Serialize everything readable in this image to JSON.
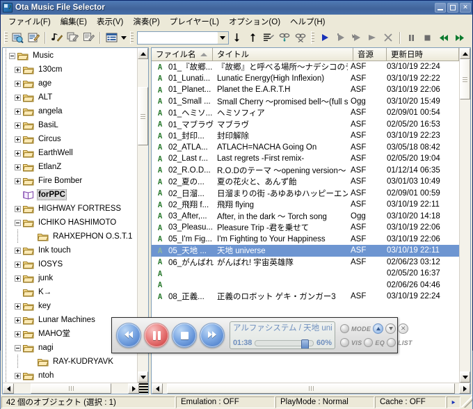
{
  "window": {
    "title": "Ota Music File Selector",
    "icon": "music-note-window-icon",
    "buttons": {
      "minimize": "_",
      "maximize": "□",
      "close": "✕"
    }
  },
  "menu": [
    {
      "label": "ファイル(F)",
      "name": "menu-file"
    },
    {
      "label": "編集(E)",
      "name": "menu-edit"
    },
    {
      "label": "表示(V)",
      "name": "menu-view"
    },
    {
      "label": "演奏(P)",
      "name": "menu-play"
    },
    {
      "label": "プレイヤー(L)",
      "name": "menu-player"
    },
    {
      "label": "オプション(O)",
      "name": "menu-options"
    },
    {
      "label": "ヘルプ(H)",
      "name": "menu-help"
    }
  ],
  "toolbar": {
    "combo_value": "",
    "combo_placeholder": "",
    "icons": [
      "search-folder-icon",
      "edit-properties-icon",
      "music-wand-icon",
      "copy-tag-icon",
      "edit-list-icon",
      "view-details-icon",
      "dropdown-arrow-icon",
      "move-down-icon",
      "move-up-icon",
      "sort-list-icon",
      "link-down-icon",
      "unlink-icon",
      "play-icon",
      "play-gray-icon",
      "play-add-icon",
      "play-next-icon",
      "clear-icon",
      "pause-icon",
      "stop-icon",
      "prev-track-icon",
      "next-track-icon"
    ]
  },
  "tree": {
    "items": [
      {
        "label": "Music",
        "depth": 0,
        "state": "minus",
        "selected": false
      },
      {
        "label": "130cm",
        "depth": 1,
        "state": "plus",
        "selected": false
      },
      {
        "label": "age",
        "depth": 1,
        "state": "plus",
        "selected": false
      },
      {
        "label": "ALT",
        "depth": 1,
        "state": "plus",
        "selected": false
      },
      {
        "label": "angela",
        "depth": 1,
        "state": "plus",
        "selected": false
      },
      {
        "label": "BasiL",
        "depth": 1,
        "state": "plus",
        "selected": false
      },
      {
        "label": "Circus",
        "depth": 1,
        "state": "plus",
        "selected": false
      },
      {
        "label": "EarthWell",
        "depth": 1,
        "state": "plus",
        "selected": false
      },
      {
        "label": "EtlanZ",
        "depth": 1,
        "state": "plus",
        "selected": false
      },
      {
        "label": "Fire Bomber",
        "depth": 1,
        "state": "plus",
        "selected": false
      },
      {
        "label": "forPPC",
        "depth": 1,
        "state": "none",
        "selected": true
      },
      {
        "label": "HIGHWAY FORTRESS",
        "depth": 1,
        "state": "plus",
        "selected": false
      },
      {
        "label": "ICHIKO HASHIMOTO",
        "depth": 1,
        "state": "minus",
        "selected": false
      },
      {
        "label": "RAHXEPHON O.S.T.1",
        "depth": 2,
        "state": "none",
        "selected": false
      },
      {
        "label": "Ink touch",
        "depth": 1,
        "state": "plus",
        "selected": false
      },
      {
        "label": "IOSYS",
        "depth": 1,
        "state": "plus",
        "selected": false
      },
      {
        "label": "junk",
        "depth": 1,
        "state": "plus",
        "selected": false
      },
      {
        "label": "K→",
        "depth": 1,
        "state": "none",
        "selected": false
      },
      {
        "label": "key",
        "depth": 1,
        "state": "plus",
        "selected": false
      },
      {
        "label": "Lunar Machines",
        "depth": 1,
        "state": "plus",
        "selected": false
      },
      {
        "label": "MAHO堂",
        "depth": 1,
        "state": "plus",
        "selected": false
      },
      {
        "label": "nagi",
        "depth": 1,
        "state": "minus",
        "selected": false
      },
      {
        "label": "RAY-KUDRYAVK",
        "depth": 2,
        "state": "none",
        "selected": false
      },
      {
        "label": "ntoh",
        "depth": 1,
        "state": "plus",
        "selected": false
      }
    ]
  },
  "filelist": {
    "columns": [
      {
        "label": "ファイル名",
        "name": "col-filename",
        "sorted": true
      },
      {
        "label": "タイトル",
        "name": "col-title",
        "sorted": false
      },
      {
        "label": "音源",
        "name": "col-source",
        "sorted": false
      },
      {
        "label": "更新日時",
        "name": "col-modified",
        "sorted": false
      }
    ],
    "rows": [
      {
        "icon": "A",
        "file": "01_『故郷...",
        "title": "『故郷』と呼べる場所〜ナデシコのテーマ〜",
        "src": "ASF",
        "date": "03/10/19 22:24",
        "selected": false
      },
      {
        "icon": "A",
        "file": "01_Lunati...",
        "title": "Lunatic Energy(High Inflexion)",
        "src": "ASF",
        "date": "03/10/19 22:22",
        "selected": false
      },
      {
        "icon": "A",
        "file": "01_Planet...",
        "title": "Planet the E.A.R.T.H",
        "src": "ASF",
        "date": "03/10/19 22:06",
        "selected": false
      },
      {
        "icon": "A",
        "file": "01_Small ...",
        "title": "Small Cherry 〜promised bell〜(full size)",
        "src": "Ogg",
        "date": "03/10/20 15:49",
        "selected": false
      },
      {
        "icon": "A",
        "file": "01_ヘミソ...",
        "title": "ヘミソフィア",
        "src": "ASF",
        "date": "02/09/01 00:54",
        "selected": false
      },
      {
        "icon": "A",
        "file": "01_マブラヴ",
        "title": "マブラヴ",
        "src": "ASF",
        "date": "02/05/20 16:53",
        "selected": false
      },
      {
        "icon": "A",
        "file": "01_封印...",
        "title": "封印解除",
        "src": "ASF",
        "date": "03/10/19 22:23",
        "selected": false
      },
      {
        "icon": "A",
        "file": "02_ATLA...",
        "title": "ATLACH=NACHA Going On",
        "src": "ASF",
        "date": "03/05/18 08:42",
        "selected": false
      },
      {
        "icon": "A",
        "file": "02_Last r...",
        "title": "Last regrets -First remix-",
        "src": "ASF",
        "date": "02/05/20 19:04",
        "selected": false
      },
      {
        "icon": "A",
        "file": "02_R.O.D...",
        "title": "R.O.Dのテーマ 〜opening version〜",
        "src": "ASF",
        "date": "01/12/14 06:35",
        "selected": false
      },
      {
        "icon": "A",
        "file": "02_夏の...",
        "title": "夏の花火と、あんず飴",
        "src": "ASF",
        "date": "03/01/03 10:49",
        "selected": false
      },
      {
        "icon": "A",
        "file": "02_日溜...",
        "title": "日溜まりの街 -あゆあゆハッピーエンドEdition-",
        "src": "ASF",
        "date": "02/09/01 00:59",
        "selected": false
      },
      {
        "icon": "A",
        "file": "02_飛翔 f...",
        "title": "飛翔 flying",
        "src": "ASF",
        "date": "03/10/19 22:11",
        "selected": false
      },
      {
        "icon": "A",
        "file": "03_After,...",
        "title": "After, in the dark 〜 Torch song",
        "src": "Ogg",
        "date": "03/10/20 14:18",
        "selected": false
      },
      {
        "icon": "A",
        "file": "03_Pleasu...",
        "title": "Pleasure Trip -君を乗せて",
        "src": "ASF",
        "date": "03/10/19 22:06",
        "selected": false
      },
      {
        "icon": "A",
        "file": "05_I'm Fig...",
        "title": "I'm Fighting to Your Happiness",
        "src": "ASF",
        "date": "03/10/19 22:06",
        "selected": false
      },
      {
        "icon": "A",
        "file": "05_天地 ...",
        "title": "天地 universe",
        "src": "ASF",
        "date": "03/10/19 22:11",
        "selected": true
      },
      {
        "icon": "A",
        "file": "06_がんばれ",
        "title": "がんばれ! 宇宙英雄隊",
        "src": "ASF",
        "date": "02/06/23 03:12",
        "selected": false
      },
      {
        "icon": "A",
        "file": "",
        "title": "",
        "src": "",
        "date": "02/05/20 16:37",
        "selected": false
      },
      {
        "icon": "A",
        "file": "",
        "title": "",
        "src": "",
        "date": "02/06/26 04:46",
        "selected": false
      },
      {
        "icon": "A",
        "file": "08_正義...",
        "title": "正義のロボット ゲキ・ガンガー3",
        "src": "ASF",
        "date": "03/10/19 22:24",
        "selected": false
      }
    ]
  },
  "player": {
    "track_title": "アルファシステム / 天地 unive",
    "time": "01:38",
    "volume_pct": "60%",
    "labels": {
      "mode": "MODE",
      "vis": "VIS",
      "eq": "EQ",
      "list": "LIST"
    },
    "buttons": [
      "rewind-button",
      "pause-button",
      "stop-button",
      "fastforward-button"
    ],
    "right_buttons": [
      "scroll-up-button",
      "scroll-down-button",
      "close-button"
    ]
  },
  "statusbar": {
    "objects": "42 個のオブジェクト (選択 : 1)",
    "emulation": "Emulation : OFF",
    "playmode": "PlayMode : Normal",
    "cache": "Cache : OFF",
    "play_icon": "play-status-icon"
  }
}
